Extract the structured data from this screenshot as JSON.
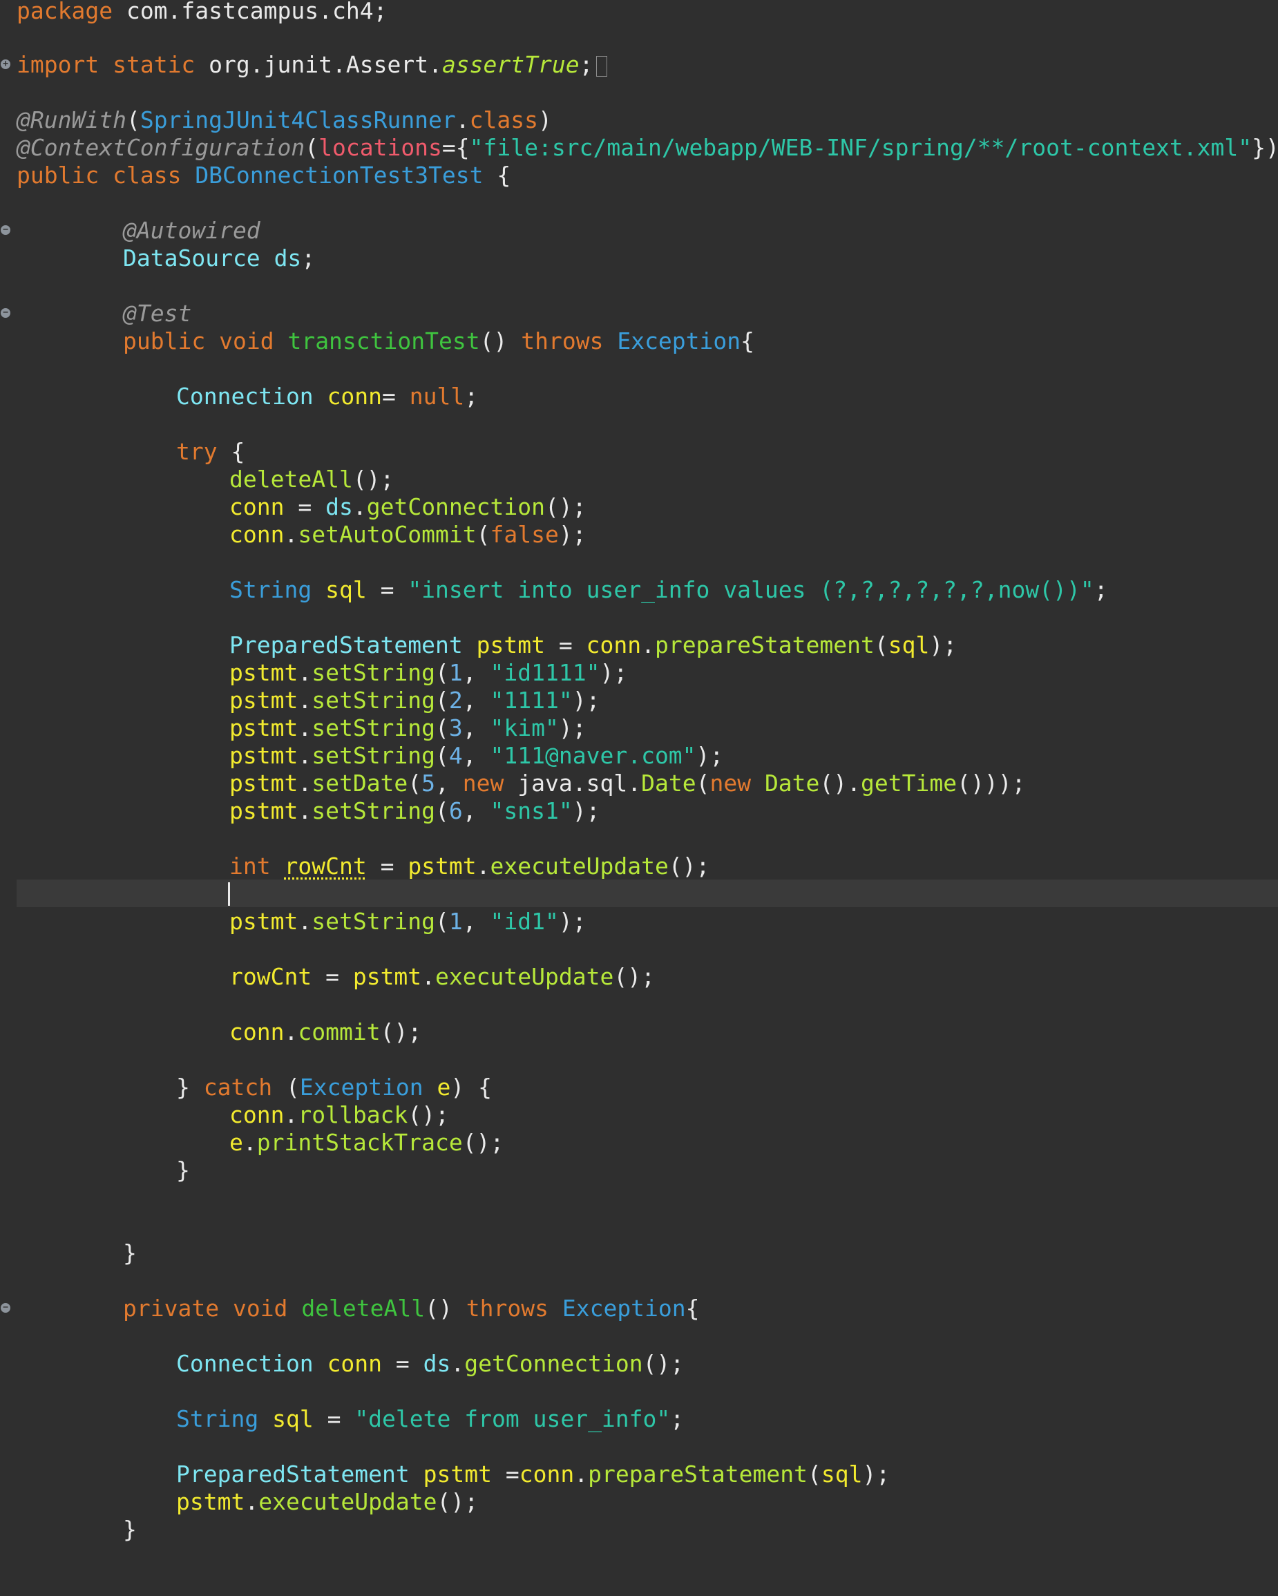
{
  "editor": {
    "lines": {
      "l_package": {
        "kw": "package",
        "rest": " com.fastcampus.ch4;"
      },
      "l_import": {
        "kw1": "import",
        "kw2": "static",
        "pkg": " org.junit.Assert.",
        "method": "assertTrue",
        "semi": ";"
      },
      "l_runwith": {
        "ann": "@RunWith",
        "open": "(",
        "type": "SpringJUnit4ClassRunner",
        "dot": ".",
        "kw": "class",
        "close": ")"
      },
      "l_ctxconf": {
        "ann": "@ContextConfiguration",
        "open": "(",
        "attr": "locations",
        "eq": "={",
        "str": "\"file:src/main/webapp/WEB-INF/spring/**/root-context.xml\"",
        "close": "})"
      },
      "l_class": {
        "kw1": "public",
        "kw2": "class",
        "name": "DBConnectionTest3Test",
        "brace": " {"
      },
      "l_autowired": {
        "ann": "@Autowired"
      },
      "l_ds": {
        "type": "DataSource",
        "field": "ds",
        "semi": ";"
      },
      "l_testann": {
        "ann": "@Test"
      },
      "l_testsig": {
        "kw1": "public",
        "kw2": "void",
        "name": "transctionTest",
        "paren": "()",
        "kw3": "throws",
        "type": "Exception",
        "brace": "{"
      },
      "l_conn_decl": {
        "type": "Connection",
        "var": "conn",
        "eq": "= ",
        "kw": "null",
        "semi": ";"
      },
      "l_try": {
        "kw": "try",
        "brace": " {"
      },
      "l_deleteall": {
        "fn": "deleteAll",
        "rest": "();"
      },
      "l_getconn": {
        "var": "conn",
        "eq": " = ",
        "field": "ds",
        "dot": ".",
        "fn": "getConnection",
        "rest": "();"
      },
      "l_autocommit": {
        "var": "conn",
        "dot": ".",
        "fn": "setAutoCommit",
        "open": "(",
        "kw": "false",
        "close": ");"
      },
      "l_sql": {
        "type": "String",
        "var": "sql",
        "eq": " = ",
        "str": "\"insert into user_info values (?,?,?,?,?,?,now())\"",
        "semi": ";"
      },
      "l_prep": {
        "type": "PreparedStatement",
        "var": "pstmt",
        "eq": " = ",
        "var2": "conn",
        "dot": ".",
        "fn": "prepareStatement",
        "open": "(",
        "arg": "sql",
        "close": ");"
      },
      "l_set1": {
        "var": "pstmt",
        "dot": ".",
        "fn": "setString",
        "open": "(",
        "num": "1",
        "comma": ", ",
        "str": "\"id1111\"",
        "close": ");"
      },
      "l_set2": {
        "var": "pstmt",
        "dot": ".",
        "fn": "setString",
        "open": "(",
        "num": "2",
        "comma": ", ",
        "str": "\"1111\"",
        "close": ");"
      },
      "l_set3": {
        "var": "pstmt",
        "dot": ".",
        "fn": "setString",
        "open": "(",
        "num": "3",
        "comma": ", ",
        "str": "\"kim\"",
        "close": ");"
      },
      "l_set4": {
        "var": "pstmt",
        "dot": ".",
        "fn": "setString",
        "open": "(",
        "num": "4",
        "comma": ", ",
        "str": "\"111@naver.com\"",
        "close": ");"
      },
      "l_setdate": {
        "var": "pstmt",
        "dot": ".",
        "fn": "setDate",
        "open": "(",
        "num": "5",
        "comma": ", ",
        "kw1": "new",
        "pkg": " java.sql.",
        "cls": "Date",
        "open2": "(",
        "kw2": "new",
        "cls2": "Date",
        "mid": "().",
        "fn2": "getTime",
        "close": "()));"
      },
      "l_set6": {
        "var": "pstmt",
        "dot": ".",
        "fn": "setString",
        "open": "(",
        "num": "6",
        "comma": ", ",
        "str": "\"sns1\"",
        "close": ");"
      },
      "l_rowcnt_decl": {
        "kw": "int",
        "var": "rowCnt",
        "eq": " = ",
        "var2": "pstmt",
        "dot": ".",
        "fn": "executeUpdate",
        "rest": "();"
      },
      "l_set_id1": {
        "var": "pstmt",
        "dot": ".",
        "fn": "setString",
        "open": "(",
        "num": "1",
        "comma": ", ",
        "str": "\"id1\"",
        "close": ");"
      },
      "l_rowcnt2": {
        "var": "rowCnt",
        "eq": " = ",
        "var2": "pstmt",
        "dot": ".",
        "fn": "executeUpdate",
        "rest": "();"
      },
      "l_commit": {
        "var": "conn",
        "dot": ".",
        "fn": "commit",
        "rest": "();"
      },
      "l_catch": {
        "brace1": "} ",
        "kw": "catch",
        "open": " (",
        "type": "Exception",
        "var": "e",
        "close": ") {"
      },
      "l_rollback": {
        "var": "conn",
        "dot": ".",
        "fn": "rollback",
        "rest": "();"
      },
      "l_stack": {
        "var": "e",
        "dot": ".",
        "fn": "printStackTrace",
        "rest": "();"
      },
      "l_close_catch": {
        "brace": "}"
      },
      "l_close_method": {
        "brace": "}"
      },
      "l_private_sig": {
        "kw1": "private",
        "kw2": "void",
        "name": "deleteAll",
        "paren": "()",
        "kw3": "throws",
        "type": "Exception",
        "brace": "{"
      },
      "l_conn2": {
        "type": "Connection",
        "var": "conn",
        "eq": " = ",
        "field": "ds",
        "dot": ".",
        "fn": "getConnection",
        "rest": "();"
      },
      "l_sql2": {
        "type": "String",
        "var": "sql",
        "eq": " = ",
        "str": "\"delete from user_info\"",
        "semi": ";"
      },
      "l_prep2": {
        "type": "PreparedStatement",
        "var": "pstmt",
        "eq": " =",
        "var2": "conn",
        "dot": ".",
        "fn": "prepareStatement",
        "open": "(",
        "arg": "sql",
        "close": ");"
      },
      "l_exec2": {
        "var": "pstmt",
        "dot": ".",
        "fn": "executeUpdate",
        "rest": "();"
      },
      "l_close_private": {
        "brace": "}"
      }
    },
    "fold_markers": {
      "import": "+",
      "autowired": "−",
      "test": "−",
      "private_method": "−"
    }
  }
}
